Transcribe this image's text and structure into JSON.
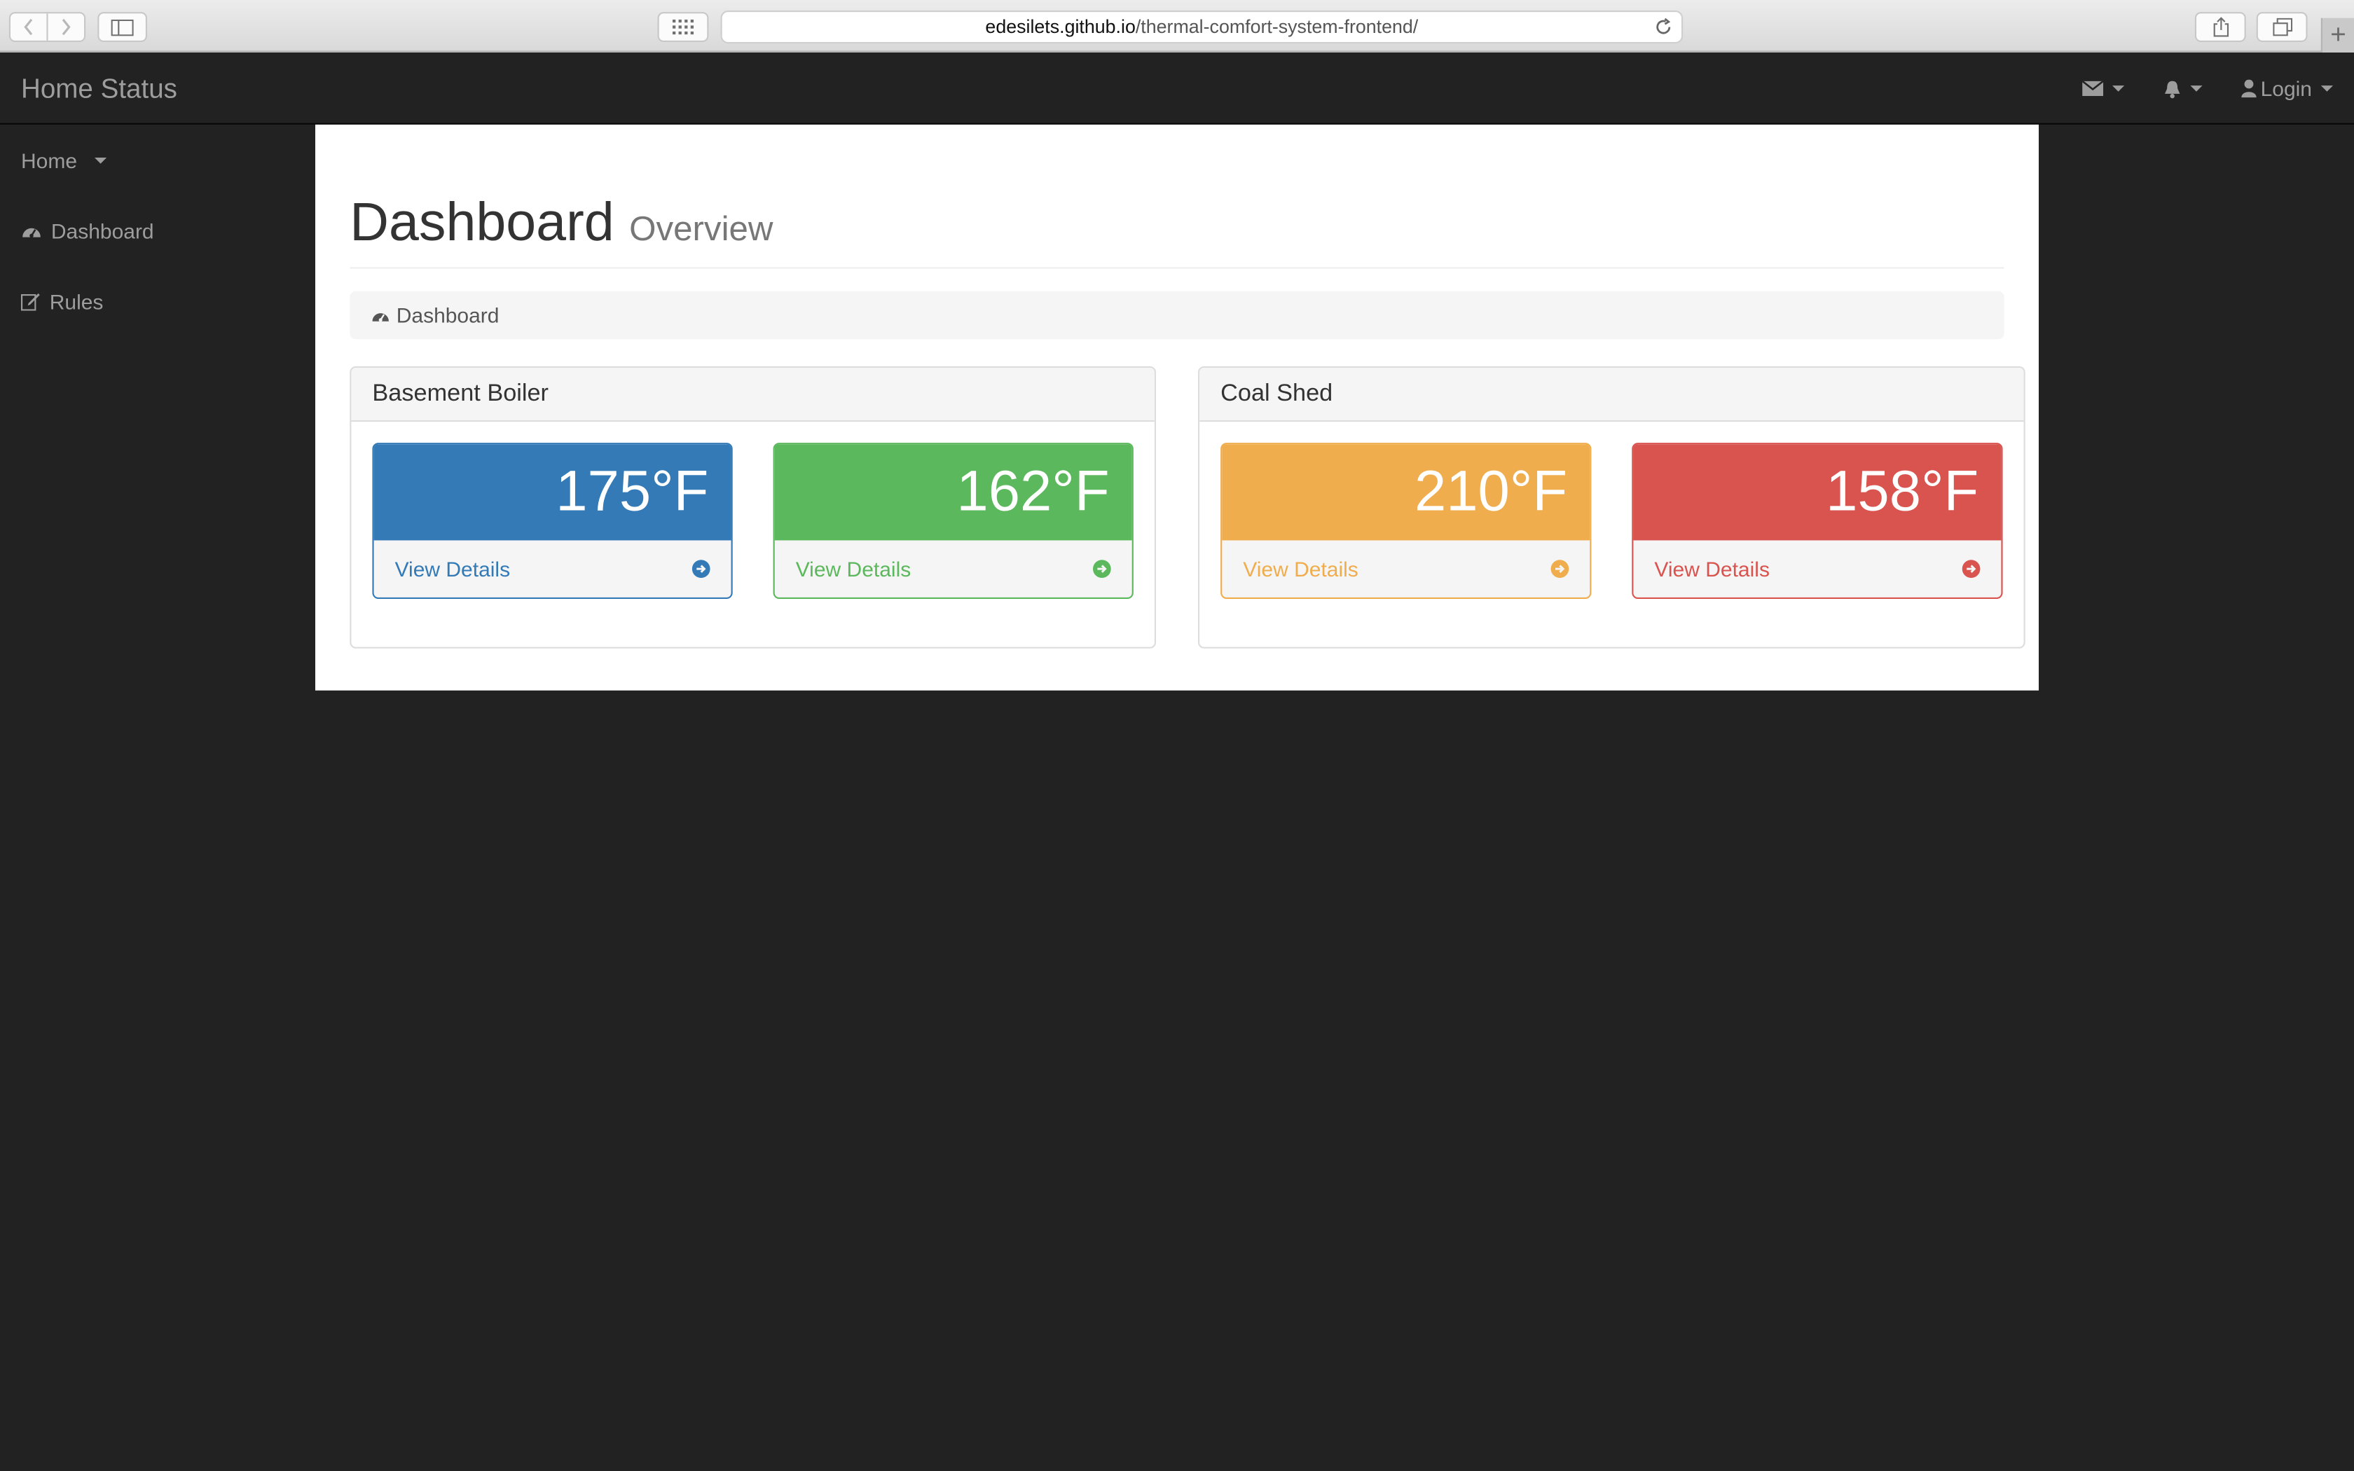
{
  "browser": {
    "url_host": "edesilets.github.io",
    "url_path": "/thermal-comfort-system-frontend/"
  },
  "navbar": {
    "brand": "Home Status",
    "login_label": "Login"
  },
  "sidebar": {
    "items": [
      {
        "label": "Home"
      },
      {
        "label": "Dashboard"
      },
      {
        "label": "Rules"
      }
    ]
  },
  "page": {
    "title": "Dashboard",
    "subtitle": "Overview",
    "breadcrumb": "Dashboard"
  },
  "panels": [
    {
      "title": "Basement Boiler",
      "cards": [
        {
          "value": "175°F",
          "link": "View Details",
          "color": "#337ab7"
        },
        {
          "value": "162°F",
          "link": "View Details",
          "color": "#5cb85c"
        }
      ]
    },
    {
      "title": "Coal Shed",
      "cards": [
        {
          "value": "210°F",
          "link": "View Details",
          "color": "#f0ad4e"
        },
        {
          "value": "158°F",
          "link": "View Details",
          "color": "#d9534f"
        }
      ]
    }
  ],
  "colors": {
    "navbar_bg": "#222222",
    "page_bg": "#ffffff",
    "primary": "#337ab7",
    "success": "#5cb85c",
    "warning": "#f0ad4e",
    "danger": "#d9534f"
  },
  "icons": {
    "mail": "envelope-icon",
    "bell": "bell-icon",
    "user": "user-icon",
    "dashboard": "dashboard-icon",
    "rules": "edit-icon",
    "arrow": "arrow-circle-right-icon"
  }
}
